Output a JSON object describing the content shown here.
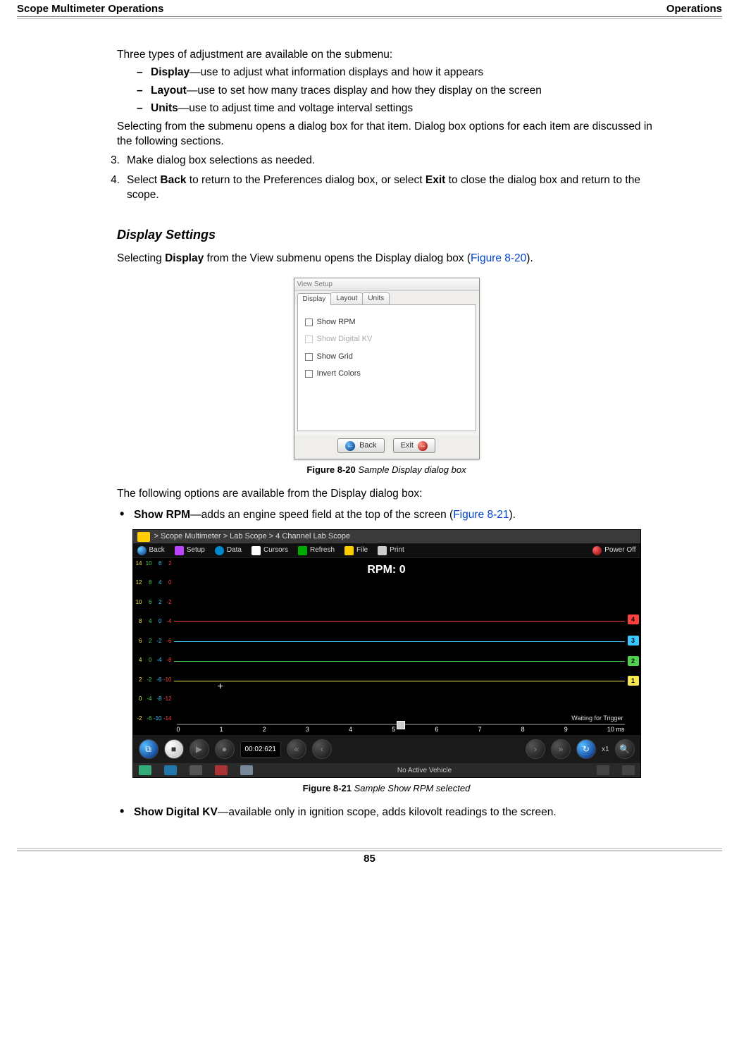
{
  "header": {
    "left": "Scope Multimeter Operations",
    "right": "Operations"
  },
  "intro": "Three types of adjustment are available on the submenu:",
  "submenu": [
    {
      "bold": "Display",
      "rest": "—use to adjust what information displays and how it appears"
    },
    {
      "bold": "Layout",
      "rest": "—use to set how many traces display and how they display on the screen"
    },
    {
      "bold": "Units",
      "rest": "—use to adjust time and voltage interval settings"
    }
  ],
  "after_submenu": "Selecting from the submenu opens a dialog box for that item. Dialog box options for each item are discussed in the following sections.",
  "steps": [
    {
      "n": "3.",
      "t": "Make dialog box selections as needed."
    },
    {
      "n": "4.",
      "pre": "Select ",
      "b1": "Back",
      "mid": " to return to the Preferences dialog box, or select ",
      "b2": "Exit",
      "post": " to close the dialog box and return to the scope."
    }
  ],
  "sect_title": "Display Settings",
  "sect_lead": {
    "pre": "Selecting ",
    "b": "Display",
    "mid": " from the View submenu opens the Display dialog box (",
    "link": "Figure 8-20",
    "post": ")."
  },
  "fig820": {
    "title": "View Setup",
    "tabs": [
      "Display",
      "Layout",
      "Units"
    ],
    "opts": [
      {
        "label": "Show RPM",
        "disabled": false
      },
      {
        "label": "Show Digital KV",
        "disabled": true
      },
      {
        "label": "Show Grid",
        "disabled": false
      },
      {
        "label": "Invert Colors",
        "disabled": false
      }
    ],
    "back": "Back",
    "exit": "Exit",
    "caption_b": "Figure 8-20 ",
    "caption_i": "Sample Display dialog box"
  },
  "after_fig820": "The following options are available from the Display dialog box:",
  "opt1": {
    "b": "Show RPM",
    "rest": "—adds an engine speed field at the top of the screen (",
    "link": "Figure 8-21",
    "post": ")."
  },
  "fig821": {
    "crumb": "> Scope Multimeter   > Lab Scope   > 4 Channel Lab Scope",
    "toolbar": [
      "Back",
      "Setup",
      "Data",
      "Cursors",
      "Refresh",
      "File",
      "Print",
      "Power Off"
    ],
    "rpm": "RPM: 0",
    "ych1": [
      "14",
      "12",
      "10",
      "8",
      "6",
      "4",
      "2",
      "0",
      "-2"
    ],
    "ych2": [
      "10",
      "8",
      "6",
      "4",
      "2",
      "0",
      "-2",
      "-4",
      "-6"
    ],
    "ych3": [
      "6",
      "4",
      "2",
      "0",
      "-2",
      "-4",
      "-6",
      "-8",
      "-10"
    ],
    "ych4": [
      "2",
      "0",
      "-2",
      "-4",
      "-6",
      "-8",
      "-10",
      "-12",
      "-14"
    ],
    "channels": [
      "4",
      "3",
      "2",
      "1"
    ],
    "wait": "Waiting for Trigger",
    "xaxis": [
      "0",
      "1",
      "2",
      "3",
      "4",
      "5",
      "6",
      "7",
      "8",
      "9",
      "10 ms"
    ],
    "time": "00:02:621",
    "zoom": "x1",
    "status": "No Active Vehicle",
    "caption_b": "Figure 8-21 ",
    "caption_i": "Sample Show RPM selected"
  },
  "opt2": {
    "b": "Show Digital KV",
    "rest": "—available only in ignition scope, adds kilovolt readings to the screen."
  },
  "pagenum": "85"
}
